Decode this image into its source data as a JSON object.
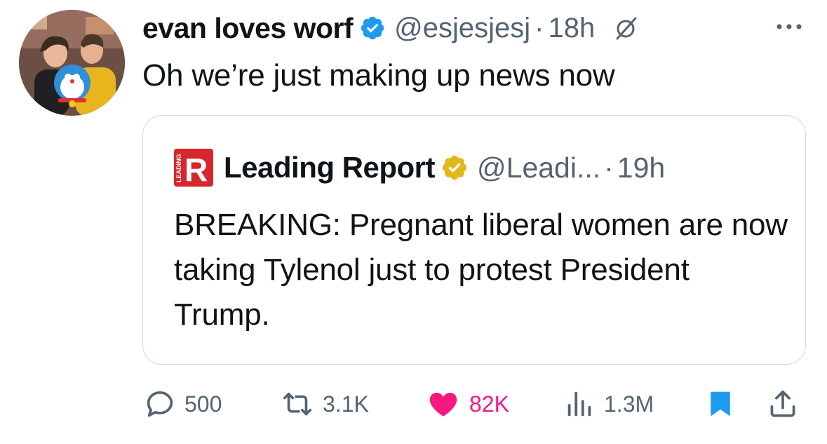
{
  "tweet": {
    "author": {
      "display_name": "evan loves worf",
      "handle": "@esjesjesj",
      "time": "18h",
      "dot": "·"
    },
    "text": "Oh we’re just making up news now"
  },
  "quote": {
    "author": {
      "display_name": "Leading Report",
      "handle": "@Leadi...",
      "time": "19h",
      "dot": "·",
      "logo_letter": "R",
      "logo_text": "LEADING"
    },
    "text": "BREAKING: Pregnant liberal women are now taking Tylenol just to protest President Trump."
  },
  "actions": {
    "replies": "500",
    "reposts": "3.1K",
    "likes": "82K",
    "views": "1.3M"
  },
  "colors": {
    "verified_blue": "#1d9bf0",
    "verified_gold": "#e2b719",
    "like_pink": "#f91880",
    "bookmark_blue": "#1d9bf0",
    "logo_red": "#d7262c",
    "secondary_text": "#536471"
  }
}
